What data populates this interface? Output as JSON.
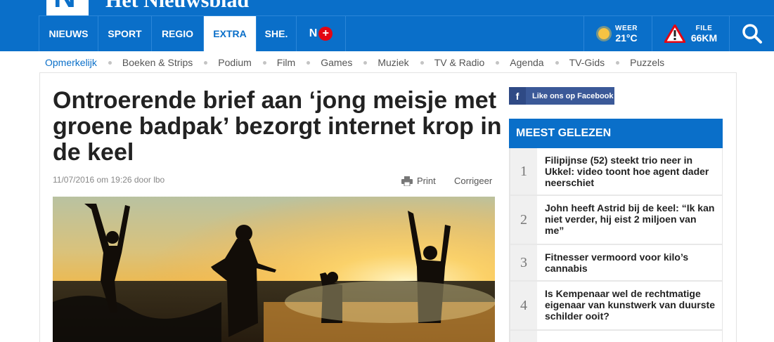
{
  "site": {
    "logo_letter": "N",
    "name": "Het Nieuwsblad"
  },
  "nav": {
    "items": [
      "NIEUWS",
      "SPORT",
      "REGIO",
      "EXTRA",
      "SHE."
    ],
    "nplus": "N",
    "weather": {
      "label": "WEER",
      "value": "21°C"
    },
    "traffic": {
      "label": "FILE",
      "value": "66KM"
    }
  },
  "subnav": [
    "Opmerkelijk",
    "Boeken & Strips",
    "Podium",
    "Film",
    "Games",
    "Muziek",
    "TV & Radio",
    "Agenda",
    "TV-Gids",
    "Puzzels"
  ],
  "article": {
    "headline": "Ontroerende brief aan ‘jong meisje met groene badpak’ bezorgt internet krop in de keel",
    "meta": "11/07/2016 om 19:26 door lbo",
    "print": "Print",
    "correct": "Corrigeer"
  },
  "sidebar": {
    "facebook": "Like ons op Facebook",
    "most_read_title": "MEEST GELEZEN",
    "most_read": [
      {
        "num": "1",
        "title": "Filipijnse (52) steekt trio neer in Ukkel: video toont hoe agent dader neerschiet"
      },
      {
        "num": "2",
        "title": "John heeft Astrid bij de keel: “Ik kan niet verder, hij eist 2 miljoen van me”"
      },
      {
        "num": "3",
        "title": "Fitnesser vermoord voor kilo’s cannabis"
      },
      {
        "num": "4",
        "title": "Is Kempenaar wel de rechtmatige eigenaar van kunstwerk van duurste schilder ooit?"
      }
    ]
  },
  "colors": {
    "brand_blue": "#0a6fc9",
    "facebook_blue": "#3b5998",
    "alert_red": "#e30613"
  }
}
